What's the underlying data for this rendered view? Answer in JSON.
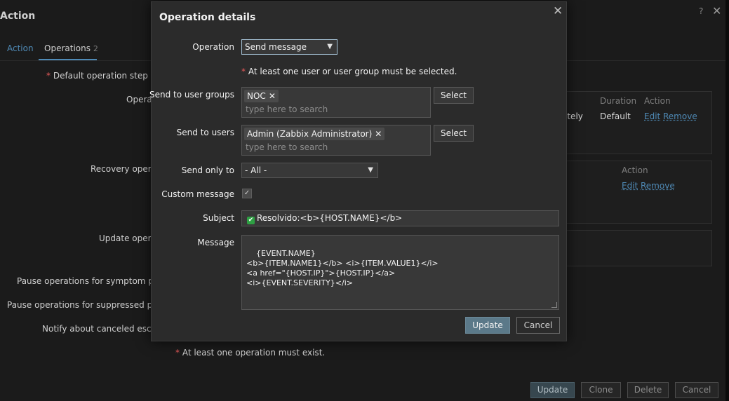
{
  "background": {
    "title": "Action",
    "help": "?",
    "close": "✕",
    "tabs": [
      {
        "label": "Action"
      },
      {
        "label": "Operations",
        "count": "2"
      }
    ],
    "fields": {
      "step_duration": "Default operation step duration",
      "operations": "Operations",
      "recovery": "Recovery operations",
      "update": "Update operations",
      "pause_symptom": "Pause operations for symptom problems",
      "pause_suppressed": "Pause operations for suppressed problems",
      "notify_canceled": "Notify about canceled escalations"
    },
    "ops_table": {
      "partial_start": "ately",
      "duration_header": "Duration",
      "action_header": "Action",
      "duration_value": "Default",
      "edit": "Edit",
      "remove": "Remove"
    },
    "recovery_table": {
      "action_header": "Action",
      "edit": "Edit",
      "remove": "Remove"
    },
    "note": "At least one operation must exist.",
    "buttons": {
      "update": "Update",
      "clone": "Clone",
      "delete": "Delete",
      "cancel": "Cancel"
    }
  },
  "modal": {
    "title": "Operation details",
    "close": "✕",
    "operation": {
      "label": "Operation",
      "value": "Send message"
    },
    "hint": "At least one user or user group must be selected.",
    "user_groups": {
      "label": "Send to user groups",
      "chip": "NOC",
      "placeholder": "type here to search",
      "button": "Select"
    },
    "users": {
      "label": "Send to users",
      "chip": "Admin (Zabbix Administrator)",
      "placeholder": "type here to search",
      "button": "Select"
    },
    "send_only_to": {
      "label": "Send only to",
      "value": "- All -"
    },
    "custom_message": {
      "label": "Custom message",
      "checked": true
    },
    "subject": {
      "label": "Subject",
      "emoji": "✔",
      "value": "Resolvido:<b>{HOST.NAME}</b>"
    },
    "message": {
      "label": "Message",
      "value": "{EVENT.NAME}\n<b>{ITEM.NAME1}</b> <i>{ITEM.VALUE1}</i>\n<a href=\"{HOST.IP}\">{HOST.IP}</a>\n<i>{EVENT.SEVERITY}</i>"
    },
    "buttons": {
      "update": "Update",
      "cancel": "Cancel"
    }
  },
  "colors": {
    "accent": "#4f8ab6",
    "primary_button": "#5b7989",
    "required": "#e45959"
  }
}
